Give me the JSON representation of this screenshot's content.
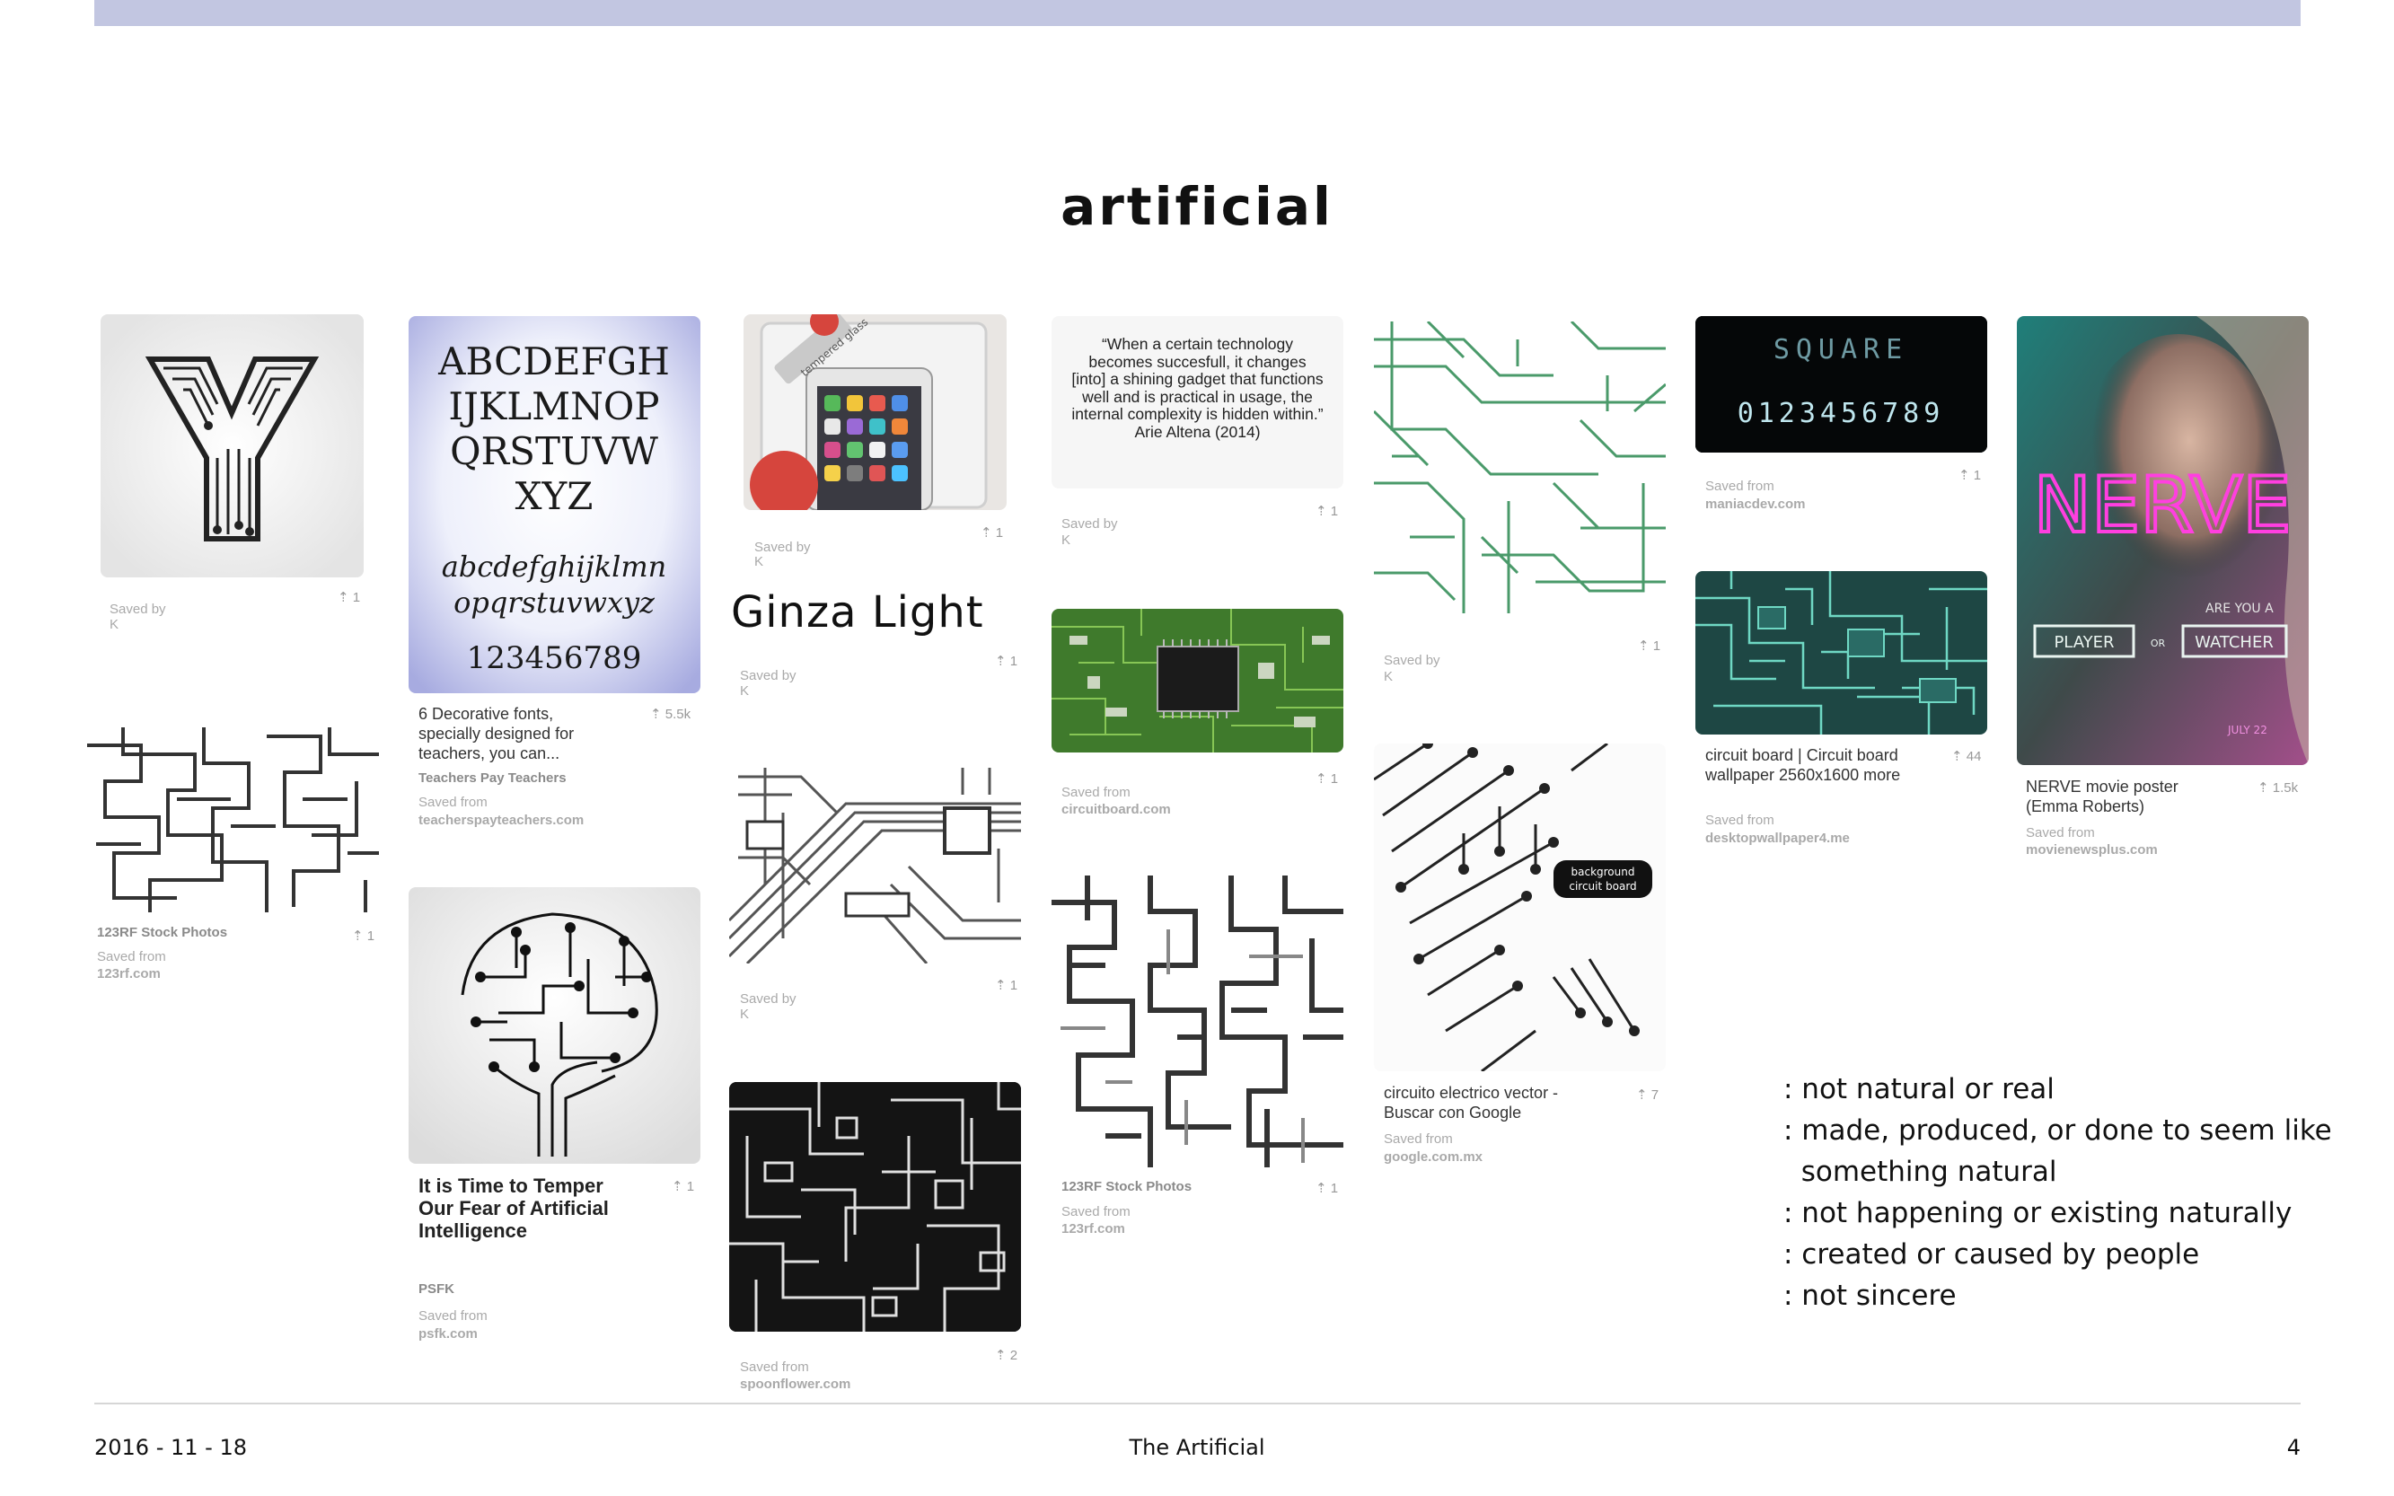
{
  "slide": {
    "title": "artificial",
    "footer_date": "2016 - 11 - 18",
    "footer_title": "The Artificial",
    "page_number": "4"
  },
  "pins": {
    "y_letter": {
      "saved_by": "Saved by",
      "saved_by_name": "K",
      "count": "1"
    },
    "stock_123rf": {
      "caption": "123RF Stock Photos",
      "saved_from": "Saved from",
      "domain": "123rf.com",
      "count": "1"
    },
    "fonts": {
      "caption": "6 Decorative fonts, specially designed for teachers, you can...",
      "source": "Teachers Pay Teachers",
      "saved_from": "Saved from",
      "domain": "teacherspayteachers.com",
      "count": "5.5k",
      "font_upper1": "ABCDEFGH",
      "font_upper2": "IJKLMNOP",
      "font_upper3": "QRSTUVW",
      "font_upper4": "XYZ",
      "font_lower1": "abcdefghijklmn",
      "font_lower2": "opqrstuvwxyz",
      "font_digits": "123456789"
    },
    "brain": {
      "caption": "It is Time to Temper Our Fear of Artificial Intelligence",
      "source": "PSFK",
      "saved_from": "Saved from",
      "domain": "psfk.com",
      "count": "1"
    },
    "phone": {
      "saved_by": "Saved by",
      "saved_by_name": "K",
      "count": "1",
      "sticker": "tempered glass"
    },
    "ginza": {
      "text": "Ginza Light",
      "saved_by": "Saved by",
      "saved_by_name": "K",
      "count": "1"
    },
    "circuit_diag": {
      "saved_by": "Saved by",
      "saved_by_name": "K",
      "count": "1"
    },
    "black_circuit": {
      "saved_from": "Saved from",
      "domain": "spoonflower.com",
      "count": "2"
    },
    "quote": {
      "text": "“When a certain technology becomes succesfull, it changes [into] a shining gadget that functions well and is practical in usage, the internal complexity is hidden within.” Arie Altena (2014)",
      "saved_by": "Saved by",
      "saved_by_name": "K",
      "count": "1"
    },
    "green_board": {
      "saved_from": "Saved from",
      "domain": "circuitboard.com",
      "count": "1"
    },
    "maze_circuit": {
      "caption": "123RF Stock Photos",
      "saved_from": "Saved from",
      "domain": "123rf.com",
      "count": "1"
    },
    "green_pattern": {
      "saved_by": "Saved by",
      "saved_by_name": "K",
      "count": "1"
    },
    "circuito": {
      "caption": "circuito electrico vector - Buscar con Google",
      "saved_from": "Saved from",
      "domain": "google.com.mx",
      "count": "7",
      "badge": "background circuit board"
    },
    "square": {
      "brand": "SQUARE",
      "digits": "0123456789",
      "saved_from": "Saved from",
      "domain": "maniacdev.com",
      "count": "1"
    },
    "teal_board": {
      "caption": "circuit board | Circuit board wallpaper 2560x1600 more",
      "saved_from": "Saved from",
      "domain": "desktopwallpaper4.me",
      "count": "44"
    },
    "nerve": {
      "caption": "NERVE movie poster (Emma Roberts)",
      "saved_from": "Saved from",
      "domain": "movienewsplus.com",
      "count": "1.5k",
      "poster_title": "NERVE",
      "poster_question": "ARE YOU A",
      "poster_player": "PLAYER",
      "poster_or": "OR",
      "poster_watcher": "WATCHER",
      "poster_date": "JULY 22"
    }
  },
  "definitions": [
    ": not natural or real",
    ": made, produced, or done to seem like",
    "  something natural",
    ": not happening or existing naturally",
    ": created or caused by people",
    ": not sincere"
  ]
}
